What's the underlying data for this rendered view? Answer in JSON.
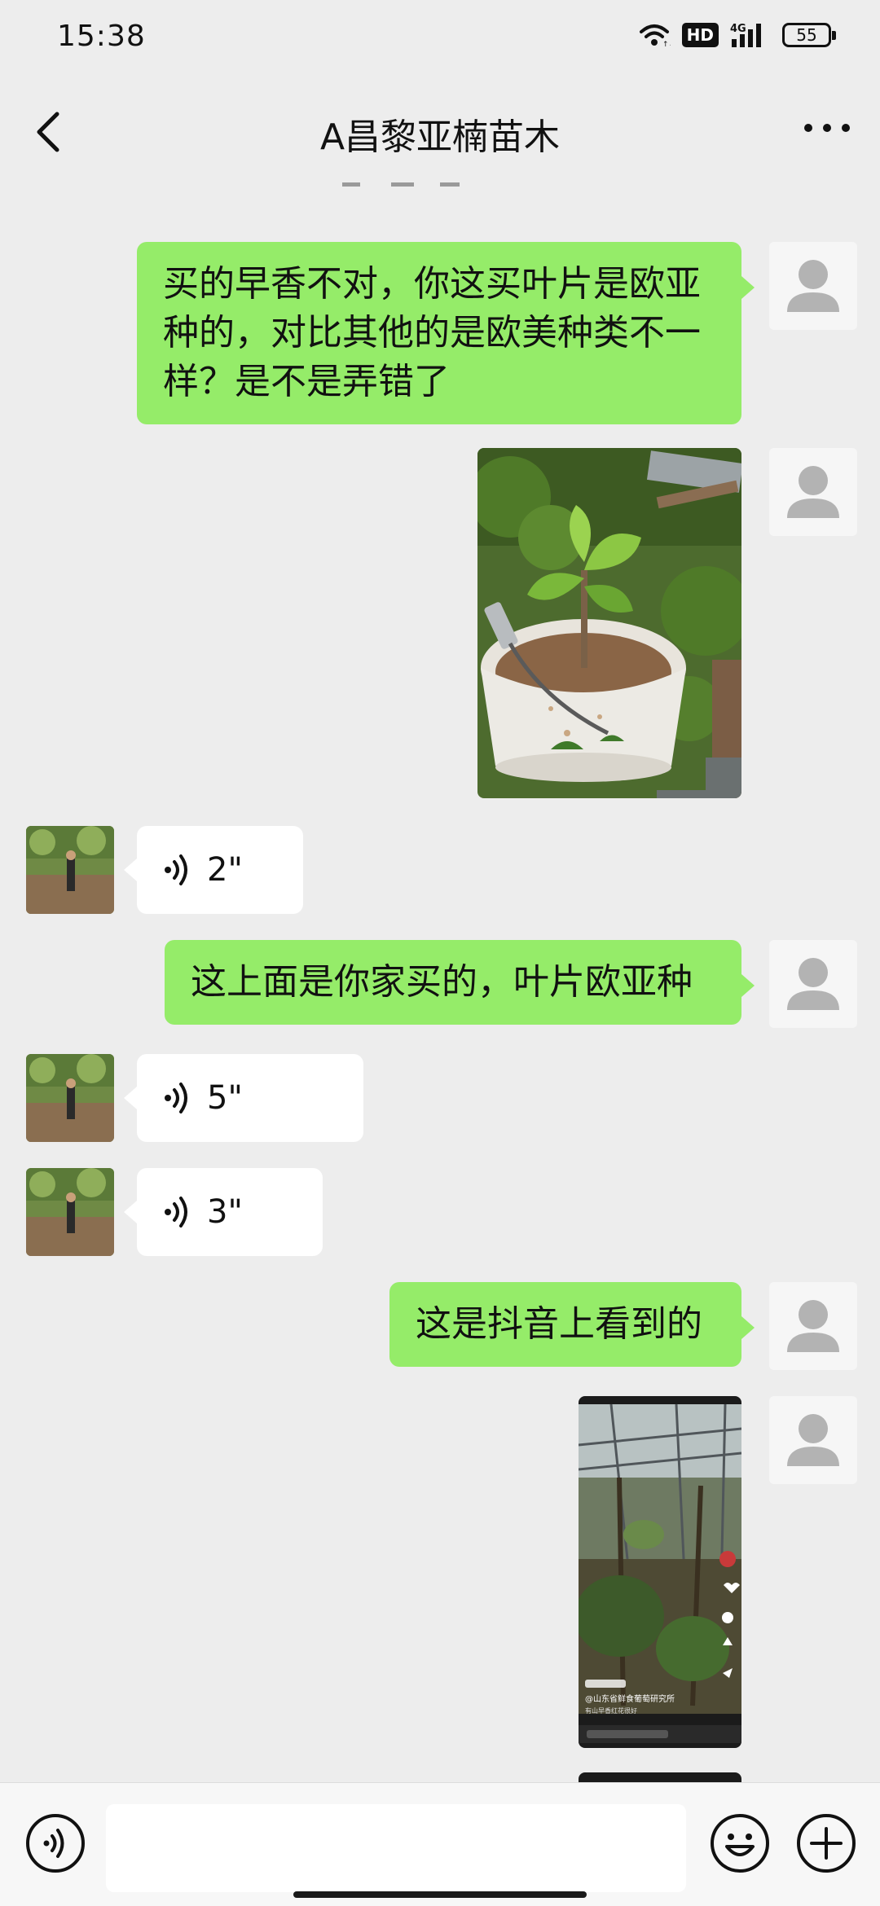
{
  "status_bar": {
    "time": "15:38",
    "hd_label": "HD",
    "network_label": "4G",
    "battery_level": "55",
    "icons": [
      "wifi-icon",
      "hd-icon",
      "signal-4g-icon",
      "battery-icon"
    ]
  },
  "header": {
    "title": "A昌黎亚楠苗木",
    "back_icon": "chevron-left-icon",
    "more_icon": "more-dots-icon"
  },
  "messages": [
    {
      "side": "me",
      "type": "text",
      "text": "买的早香不对，你这买叶片是欧亚种的，对比其他的是欧美种类不一样？是不是弄错了"
    },
    {
      "side": "me",
      "type": "image",
      "subject": "grape-seedling-in-bucket-photo"
    },
    {
      "side": "them",
      "type": "voice",
      "duration": "2\""
    },
    {
      "side": "me",
      "type": "text",
      "text": "这上面是你家买的，叶片欧亚种"
    },
    {
      "side": "them",
      "type": "voice",
      "duration": "5\""
    },
    {
      "side": "them",
      "type": "voice",
      "duration": "3\""
    },
    {
      "side": "me",
      "type": "text",
      "text": "这是抖音上看到的"
    },
    {
      "side": "me",
      "type": "image",
      "subject": "douyin-video-screenshot",
      "caption_title": "@山东省鲜食葡萄研究所",
      "caption_sub": "有山早香红花很好"
    }
  ],
  "input_bar": {
    "voice_icon": "voice-input-icon",
    "input_value": "",
    "emoji_icon": "emoji-icon",
    "plus_icon": "plus-icon"
  },
  "colors": {
    "background": "#ededed",
    "my_bubble": "#95ec69",
    "their_bubble": "#ffffff"
  }
}
